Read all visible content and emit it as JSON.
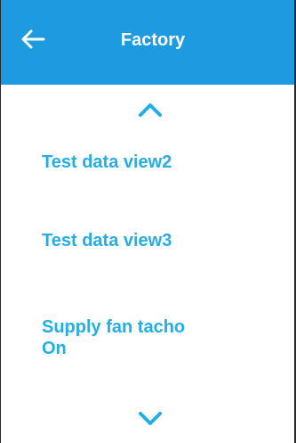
{
  "header": {
    "title": "Factory",
    "back_icon": "arrow-left-icon",
    "background_color": "#1e9be0"
  },
  "nav": {
    "scroll_up_icon": "chevron-up-icon",
    "scroll_down_icon": "chevron-down-icon",
    "accent_color": "#22aee6"
  },
  "list": {
    "items": [
      {
        "label": "Test data view2"
      },
      {
        "label": "Test data view3"
      },
      {
        "label_line1": "Supply fan tacho",
        "label_line2": "On"
      }
    ]
  }
}
